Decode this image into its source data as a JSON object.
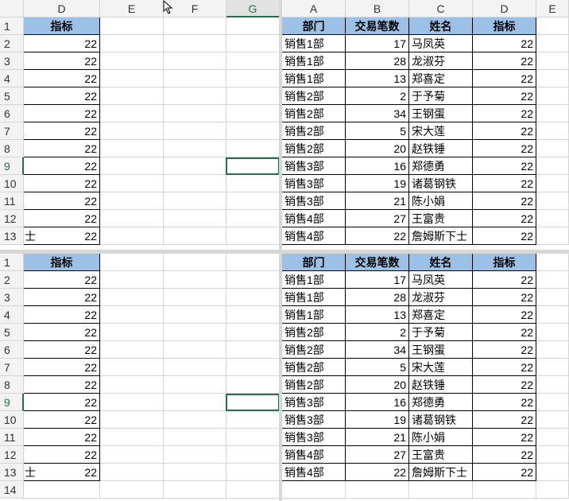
{
  "left_columns": [
    "D",
    "E",
    "F",
    "G"
  ],
  "right_columns": [
    "A",
    "B",
    "C",
    "D",
    "E"
  ],
  "rows": [
    "1",
    "2",
    "3",
    "4",
    "5",
    "6",
    "7",
    "8",
    "9",
    "10",
    "11",
    "12",
    "13",
    "14"
  ],
  "headers": {
    "dept": "部门",
    "count": "交易笔数",
    "name": "姓名",
    "target": "指标"
  },
  "left_col_D_header": "指标",
  "col_A_overflow_text": "士",
  "data": [
    {
      "dept": "销售1部",
      "count": "17",
      "name": "马凤英",
      "target": "22"
    },
    {
      "dept": "销售1部",
      "count": "28",
      "name": "龙淑芬",
      "target": "22"
    },
    {
      "dept": "销售1部",
      "count": "13",
      "name": "郑喜定",
      "target": "22"
    },
    {
      "dept": "销售2部",
      "count": "2",
      "name": "于予菊",
      "target": "22"
    },
    {
      "dept": "销售2部",
      "count": "34",
      "name": "王钢蛋",
      "target": "22"
    },
    {
      "dept": "销售2部",
      "count": "5",
      "name": "宋大莲",
      "target": "22"
    },
    {
      "dept": "销售2部",
      "count": "20",
      "name": "赵铁锤",
      "target": "22"
    },
    {
      "dept": "销售3部",
      "count": "16",
      "name": "郑德勇",
      "target": "22"
    },
    {
      "dept": "销售3部",
      "count": "19",
      "name": "诸葛钢铁",
      "target": "22"
    },
    {
      "dept": "销售3部",
      "count": "21",
      "name": "陈小娟",
      "target": "22"
    },
    {
      "dept": "销售4部",
      "count": "27",
      "name": "王富贵",
      "target": "22"
    },
    {
      "dept": "销售4部",
      "count": "22",
      "name": "詹姆斯下士",
      "target": "22"
    }
  ],
  "selected_row": "9",
  "selected_column": "G",
  "colors": {
    "header_fill": "#9bc2e6",
    "selection": "#217346",
    "grid": "#d4d4d4"
  }
}
